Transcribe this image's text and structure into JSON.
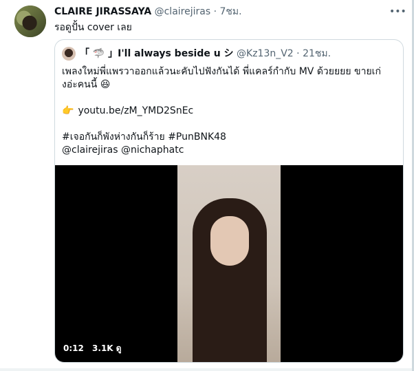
{
  "tweet": {
    "author_name": "CLAIRE JIRASSAYA",
    "author_handle": "@clairejiras",
    "separator": "·",
    "time": "7ชม.",
    "text": "รอดูปั้น cover เลย",
    "more_icon": "ellipsis-horizontal-icon"
  },
  "quote": {
    "name": "「 🦈 」I'll always beside u シ",
    "handle": "@Kz13n_V2",
    "separator": "·",
    "time": "21ชม.",
    "line1": "เพลงใหม่พี่แพรวาออกแล้วนะคับไปฟังกันได้ พี่แคลร์กำกับ MV ด้วยยยย ขายเก่",
    "line2": "งอ่ะคนนี้ 😆",
    "link": "youtu.be/zM_YMD2SnEc",
    "hashtags": "#เจอกันก็พังห่างกันก็ร้าย #PunBNK48",
    "mentions": "@clairejiras @nichaphatc",
    "video": {
      "duration": "0:12",
      "views": "3.1K ดู"
    }
  }
}
